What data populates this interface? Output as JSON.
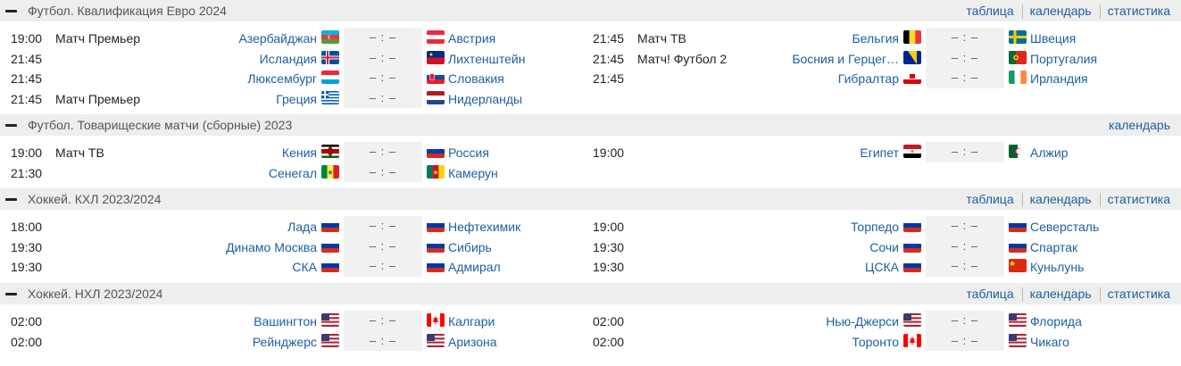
{
  "score_placeholder": "– : –",
  "sections": [
    {
      "title": "Футбол. Квалификация Евро 2024",
      "links": [
        "таблица",
        "календарь",
        "статистика"
      ],
      "left": [
        {
          "time": "19:00",
          "tv": "Матч Премьер",
          "home": "Азербайджан",
          "home_flag": "azerbaijan",
          "away": "Австрия",
          "away_flag": "austria"
        },
        {
          "time": "21:45",
          "tv": "",
          "home": "Исландия",
          "home_flag": "iceland",
          "away": "Лихтенштейн",
          "away_flag": "liechtenstein"
        },
        {
          "time": "21:45",
          "tv": "",
          "home": "Люксембург",
          "home_flag": "luxembourg",
          "away": "Словакия",
          "away_flag": "slovakia"
        },
        {
          "time": "21:45",
          "tv": "Матч Премьер",
          "home": "Греция",
          "home_flag": "greece",
          "away": "Нидерланды",
          "away_flag": "netherlands"
        }
      ],
      "right": [
        {
          "time": "21:45",
          "tv": "Матч ТВ",
          "home": "Бельгия",
          "home_flag": "belgium",
          "away": "Швеция",
          "away_flag": "sweden"
        },
        {
          "time": "21:45",
          "tv": "Матч! Футбол 2",
          "home": "Босния и Герцег…",
          "home_flag": "bosnia",
          "away": "Португалия",
          "away_flag": "portugal"
        },
        {
          "time": "21:45",
          "tv": "",
          "home": "Гибралтар",
          "home_flag": "gibraltar",
          "away": "Ирландия",
          "away_flag": "ireland"
        }
      ]
    },
    {
      "title": "Футбол. Товарищеские матчи (сборные) 2023",
      "links": [
        "календарь"
      ],
      "left": [
        {
          "time": "19:00",
          "tv": "Матч ТВ",
          "home": "Кения",
          "home_flag": "kenya",
          "away": "Россия",
          "away_flag": "russia"
        },
        {
          "time": "21:30",
          "tv": "",
          "home": "Сенегал",
          "home_flag": "senegal",
          "away": "Камерун",
          "away_flag": "cameroon"
        }
      ],
      "right": [
        {
          "time": "19:00",
          "tv": "",
          "home": "Египет",
          "home_flag": "egypt",
          "away": "Алжир",
          "away_flag": "algeria"
        }
      ]
    },
    {
      "title": "Хоккей. КХЛ 2023/2024",
      "links": [
        "таблица",
        "календарь",
        "статистика"
      ],
      "left": [
        {
          "time": "18:00",
          "tv": "",
          "home": "Лада",
          "home_flag": "russia",
          "away": "Нефтехимик",
          "away_flag": "russia"
        },
        {
          "time": "19:30",
          "tv": "",
          "home": "Динамо Москва",
          "home_flag": "russia",
          "away": "Сибирь",
          "away_flag": "russia"
        },
        {
          "time": "19:30",
          "tv": "",
          "home": "СКА",
          "home_flag": "russia",
          "away": "Адмирал",
          "away_flag": "russia"
        }
      ],
      "right": [
        {
          "time": "19:00",
          "tv": "",
          "home": "Торпедо",
          "home_flag": "russia",
          "away": "Северсталь",
          "away_flag": "russia"
        },
        {
          "time": "19:30",
          "tv": "",
          "home": "Сочи",
          "home_flag": "russia",
          "away": "Спартак",
          "away_flag": "russia"
        },
        {
          "time": "19:30",
          "tv": "",
          "home": "ЦСКА",
          "home_flag": "russia",
          "away": "Куньлунь",
          "away_flag": "china"
        }
      ]
    },
    {
      "title": "Хоккей. НХЛ 2023/2024",
      "links": [
        "таблица",
        "календарь",
        "статистика"
      ],
      "left": [
        {
          "time": "02:00",
          "tv": "",
          "home": "Вашингтон",
          "home_flag": "usa",
          "away": "Калгари",
          "away_flag": "canada"
        },
        {
          "time": "02:00",
          "tv": "",
          "home": "Рейнджерс",
          "home_flag": "usa",
          "away": "Аризона",
          "away_flag": "usa"
        }
      ],
      "right": [
        {
          "time": "02:00",
          "tv": "",
          "home": "Нью-Джерси",
          "home_flag": "usa",
          "away": "Флорида",
          "away_flag": "usa"
        },
        {
          "time": "02:00",
          "tv": "",
          "home": "Торонто",
          "home_flag": "canada",
          "away": "Чикаго",
          "away_flag": "usa"
        }
      ]
    }
  ]
}
